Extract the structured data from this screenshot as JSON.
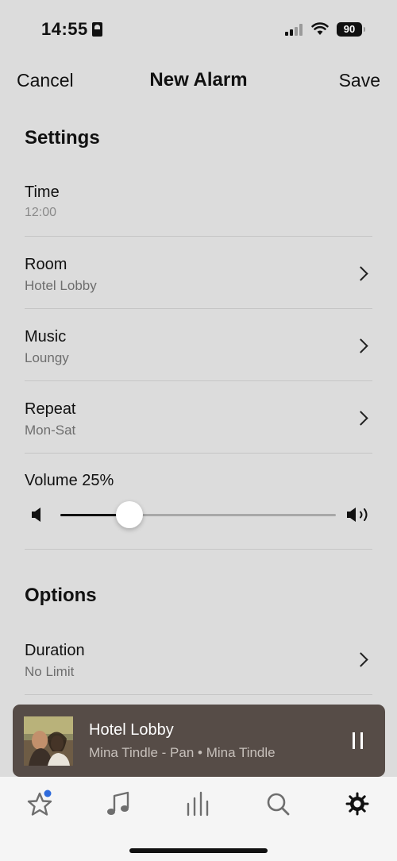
{
  "status_bar": {
    "time": "14:55",
    "battery": "90",
    "icons": [
      "contact-card-icon",
      "cellular-signal-icon",
      "wifi-icon",
      "battery-icon"
    ]
  },
  "nav": {
    "cancel_label": "Cancel",
    "title": "New Alarm",
    "save_label": "Save"
  },
  "settings": {
    "title": "Settings",
    "time": {
      "label": "Time",
      "value": "12:00"
    },
    "room": {
      "label": "Room",
      "value": "Hotel Lobby"
    },
    "music": {
      "label": "Music",
      "value": "Loungy"
    },
    "repeat": {
      "label": "Repeat",
      "value": "Mon-Sat"
    },
    "volume": {
      "label": "Volume 25%",
      "level": 0.25
    }
  },
  "options": {
    "title": "Options",
    "duration": {
      "label": "Duration",
      "value": "No Limit"
    }
  },
  "now_playing": {
    "title": "Hotel Lobby",
    "subtitle": "Mina Tindle - Pan • Mina Tindle"
  },
  "tab_bar": {
    "tabs": [
      "favorites-star-icon",
      "music-note-icon",
      "equalizer-bars-icon",
      "search-icon",
      "settings-gear-icon"
    ],
    "selected": "settings-gear-icon",
    "notification_dot_color": "#2e6bdc"
  },
  "colors": {
    "background": "#dcdcdc",
    "now_playing_bg": "#564c47",
    "tab_bar_bg": "#f5f5f5"
  }
}
